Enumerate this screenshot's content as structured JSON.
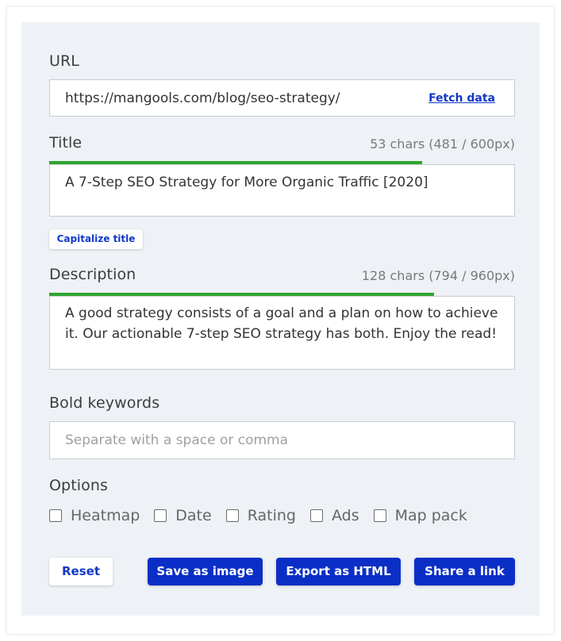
{
  "url": {
    "label": "URL",
    "value": "https://mangools.com/blog/seo-strategy/",
    "fetch_label": "Fetch data"
  },
  "title": {
    "label": "Title",
    "counter": "53 chars (481 / 600px)",
    "value": "A 7-Step SEO Strategy for More Organic Traffic [2020]",
    "length_progress": 0.8,
    "capitalize_label": "Capitalize title"
  },
  "description": {
    "label": "Description",
    "counter": "128 chars (794 / 960px)",
    "value": "A good strategy consists of a goal and a plan on how to achieve it. Our actionable 7-step SEO strategy has both. Enjoy the read!",
    "length_progress": 0.827
  },
  "keywords": {
    "label": "Bold keywords",
    "placeholder": "Separate with a space or comma",
    "value": ""
  },
  "options": {
    "label": "Options",
    "items": [
      {
        "label": "Heatmap",
        "checked": false
      },
      {
        "label": "Date",
        "checked": false
      },
      {
        "label": "Rating",
        "checked": false
      },
      {
        "label": "Ads",
        "checked": false
      },
      {
        "label": "Map pack",
        "checked": false
      }
    ]
  },
  "actions": {
    "reset": "Reset",
    "save_image": "Save as image",
    "export_html": "Export as HTML",
    "share_link": "Share a link"
  },
  "colors": {
    "accent": "#0b2fc6",
    "progress": "#2fa52f",
    "panel_bg": "#eef1f5"
  }
}
